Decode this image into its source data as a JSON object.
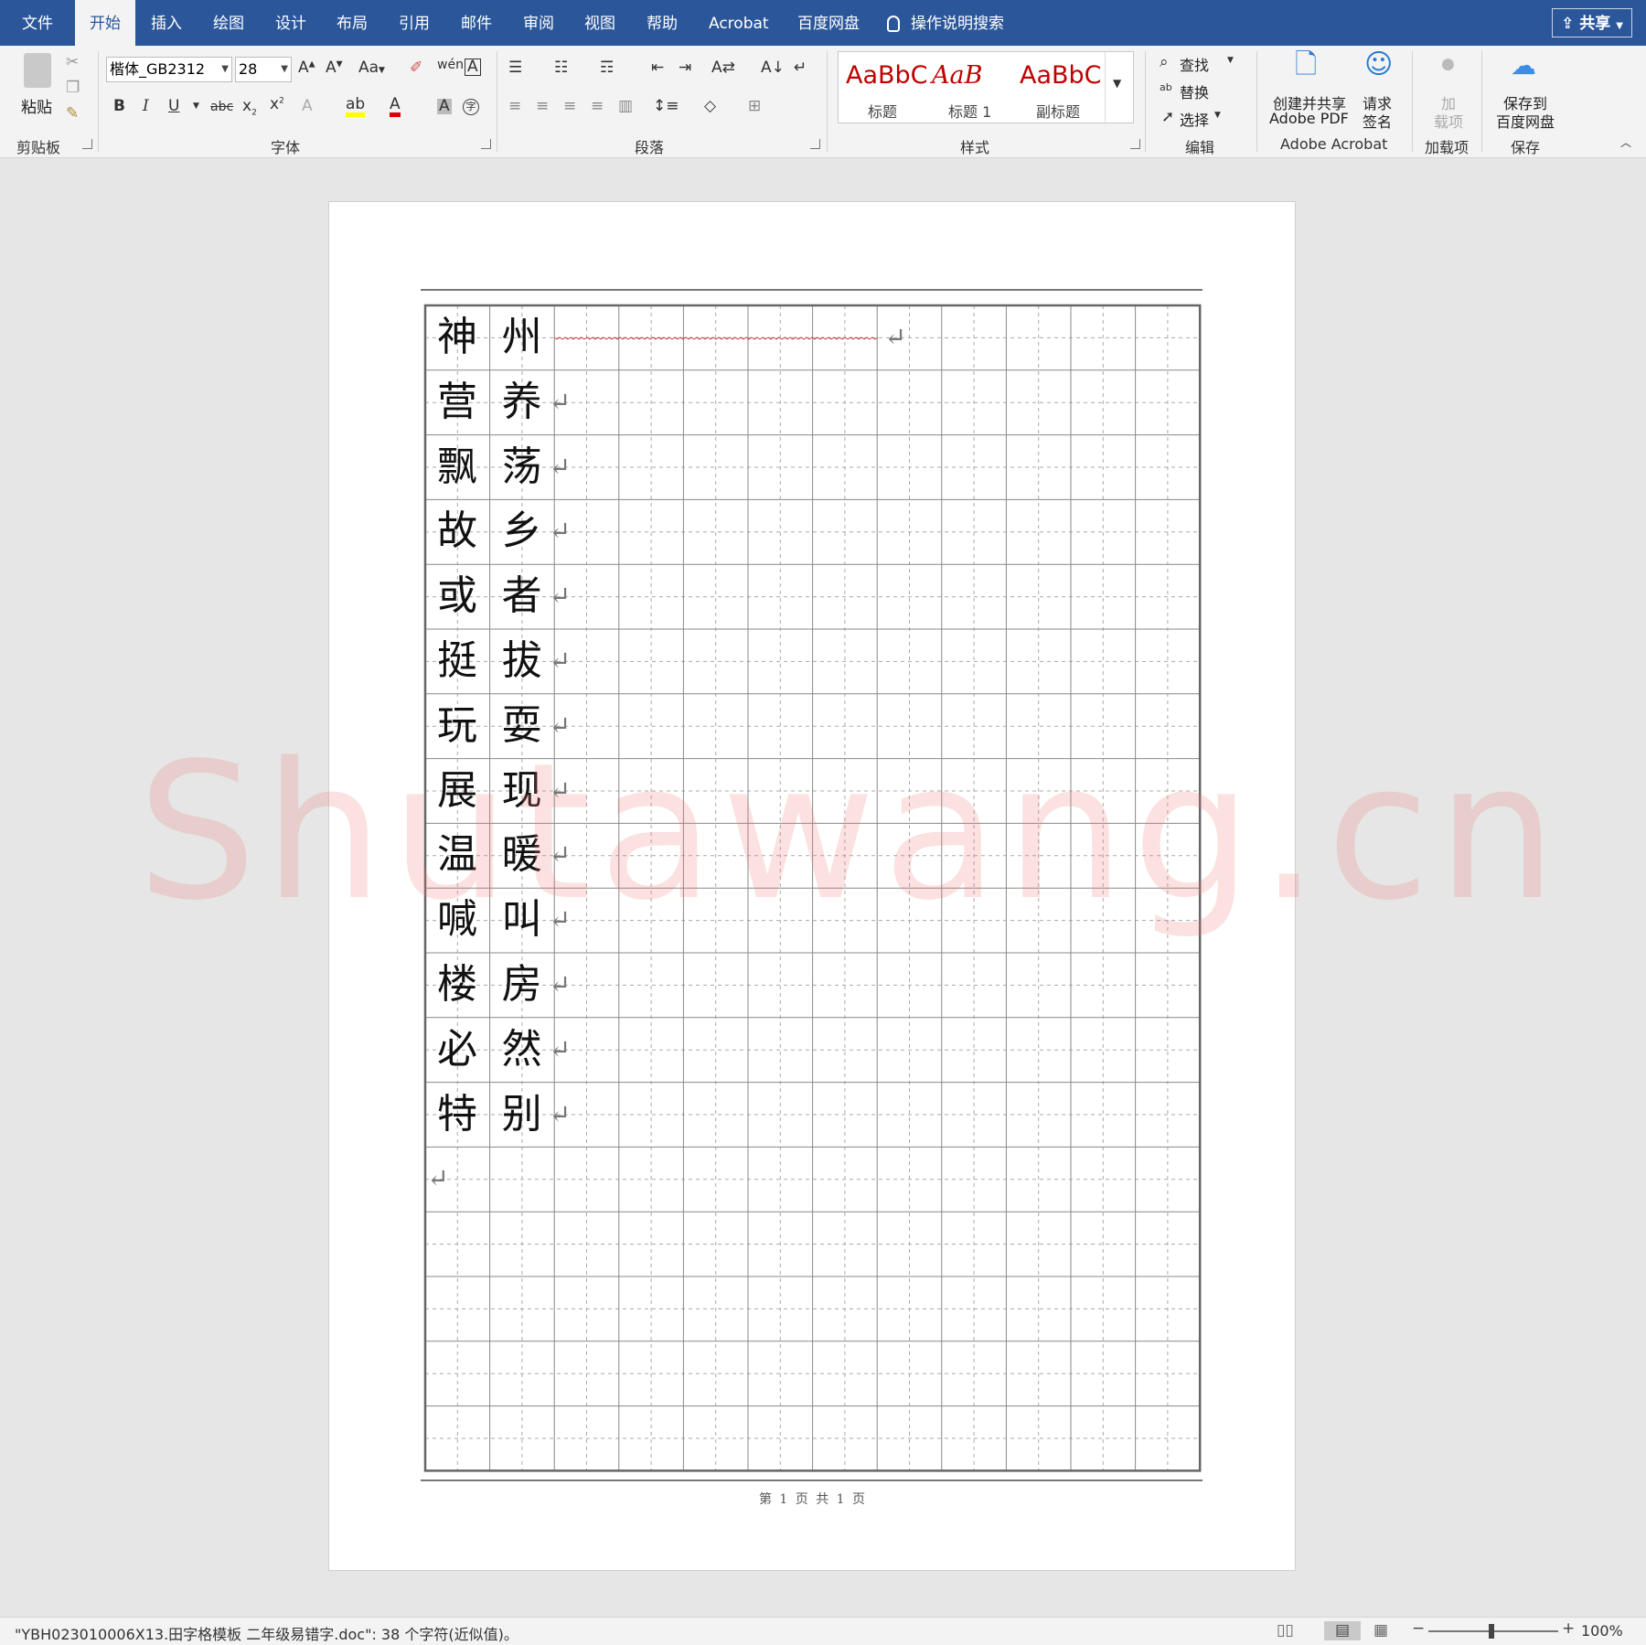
{
  "tabs": [
    "文件",
    "开始",
    "插入",
    "绘图",
    "设计",
    "布局",
    "引用",
    "邮件",
    "审阅",
    "视图",
    "帮助",
    "Acrobat",
    "百度网盘"
  ],
  "tell_me": "操作说明搜索",
  "share": "共享",
  "ribbon": {
    "clipboard": {
      "paste": "粘贴",
      "label": "剪贴板"
    },
    "font": {
      "name": "楷体_GB2312",
      "size": "28",
      "change_case": "Aa",
      "label": "字体"
    },
    "paragraph": {
      "label": "段落"
    },
    "styles": {
      "items": [
        {
          "sample": "AaBbC",
          "name": "标题"
        },
        {
          "sample": "AaB",
          "name": "标题 1"
        },
        {
          "sample": "AaBbC",
          "name": "副标题"
        }
      ],
      "label": "样式"
    },
    "editing": {
      "find": "查找",
      "replace": "替换",
      "select": "选择",
      "label": "编辑"
    },
    "acrobat": {
      "create_line1": "创建并共享",
      "create_line2": "Adobe PDF",
      "sign_line1": "请求",
      "sign_line2": "签名",
      "label": "Adobe Acrobat"
    },
    "addins": {
      "line1": "加",
      "line2": "载项",
      "label": "加载项"
    },
    "save": {
      "line1": "保存到",
      "line2": "百度网盘",
      "label": "保存"
    }
  },
  "document": {
    "rows": [
      [
        "神",
        "州"
      ],
      [
        "营",
        "养"
      ],
      [
        "飘",
        "荡"
      ],
      [
        "故",
        "乡"
      ],
      [
        "或",
        "者"
      ],
      [
        "挺",
        "拔"
      ],
      [
        "玩",
        "耍"
      ],
      [
        "展",
        "现"
      ],
      [
        "温",
        "暖"
      ],
      [
        "喊",
        "叫"
      ],
      [
        "楼",
        "房"
      ],
      [
        "必",
        "然"
      ],
      [
        "特",
        "别"
      ]
    ],
    "footer": "第 1 页 共 1 页"
  },
  "watermark": "Shutawang.cn",
  "status": {
    "text": "\"YBH023010006X13.田字格模板 二年级易错字.doc\": 38 个字符(近似值)。",
    "zoom": "100%"
  },
  "colors": {
    "title_bar": "#2b579a",
    "accent_red": "#c00000"
  }
}
